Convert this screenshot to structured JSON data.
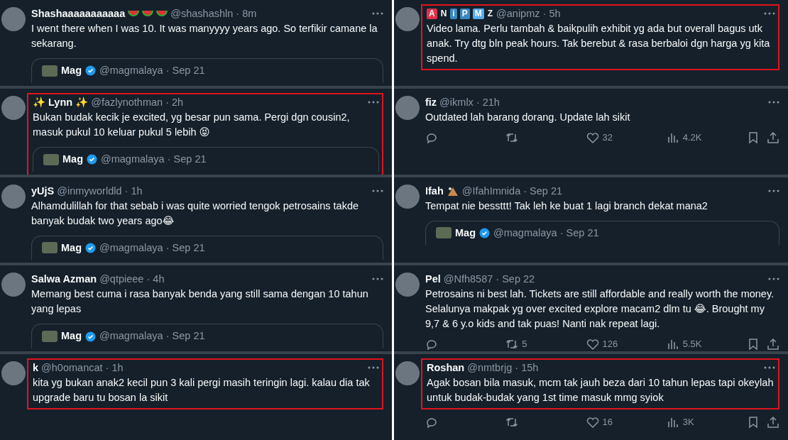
{
  "columns": [
    {
      "tweets": [
        {
          "name": "Shashaaaaaaaaaaa",
          "name_icons": [
            {
              "kind": "watermelon"
            },
            {
              "kind": "watermelon"
            },
            {
              "kind": "watermelon"
            }
          ],
          "meta": "@shashashln · 8m",
          "highlighted": false,
          "text": "I went there when I was 10. It was manyyyy years ago. So terfikir camane la sekarang.",
          "quote": {
            "name": "Mag",
            "meta": "@magmalaya · Sep 21"
          }
        },
        {
          "name": "✨ Lynn ✨",
          "meta": "@fazlynothman · 2h",
          "highlighted": true,
          "text": "Bukan budak kecik je excited, yg besar pun sama. Pergi dgn cousin2, masuk pukul 10 keluar pukul 5 lebih 😝",
          "quote": {
            "name": "Mag",
            "meta": "@magmalaya · Sep 21"
          }
        },
        {
          "name": "yUjS",
          "meta": "@inmyworldld · 1h",
          "highlighted": false,
          "text": "Alhamdulillah for that sebab i was quite worried tengok petrosains takde banyak budak two years ago😂",
          "quote": {
            "name": "Mag",
            "meta": "@magmalaya · Sep 21"
          }
        },
        {
          "name": "Salwa Azman",
          "meta": "@qtpieee · 4h",
          "highlighted": false,
          "text": "Memang best cuma i rasa banyak benda yang still sama dengan 10 tahun yang lepas",
          "quote": {
            "name": "Mag",
            "meta": "@magmalaya · Sep 21"
          }
        },
        {
          "name": "k",
          "meta": "@h0omancat · 1h",
          "highlighted": true,
          "text": "kita yg bukan anak2 kecil pun 3 kali pergi masih teringin lagi. kalau dia tak upgrade baru tu bosan la sikit"
        }
      ]
    },
    {
      "tweets": [
        {
          "name_letters": [
            {
              "letter": "A",
              "color": "#e0314b"
            },
            {
              "letter": "N"
            },
            {
              "letter": "i",
              "color": "#3b88c3"
            },
            {
              "letter": "P",
              "color": "#3b88c3"
            },
            {
              "letter": "M",
              "color": "#55acee"
            },
            {
              "letter": "Z"
            }
          ],
          "meta": "@anipmz · 5h",
          "highlighted": true,
          "text": "Video lama. Perlu tambah & baikpulih exhibit yg ada but overall bagus utk anak. Try dtg bln peak hours. Tak berebut & rasa berbaloi dgn harga yg kita spend."
        },
        {
          "name": "fiz",
          "meta": "@ikmlx · 21h",
          "highlighted": false,
          "text": "Outdated lah barang dorang. Update lah sikit",
          "actions": {
            "likes": "32",
            "views": "4.2K"
          }
        },
        {
          "name": "Ifah",
          "name_icons": [
            {
              "kind": "tent"
            }
          ],
          "meta": "@IfahImnida · Sep 21",
          "highlighted": false,
          "text": "Tempat nie bessttt! Tak leh ke buat 1 lagi branch dekat mana2",
          "quote": {
            "name": "Mag",
            "meta": "@magmalaya · Sep 21"
          }
        },
        {
          "name": "Pel",
          "meta": "@Nfh8587 · Sep 22",
          "highlighted": false,
          "text": "Petrosains ni best lah. Tickets are still affordable and really worth the money. Selalunya makpak yg over excited explore macam2 dlm tu 😂. Brought my 9,7 & 6 y.o kids and tak puas! Nanti nak repeat lagi.",
          "actions": {
            "retweets": "5",
            "likes": "126",
            "views": "5.5K"
          }
        },
        {
          "name": "Roshan",
          "meta": "@nmtbrjg · 15h",
          "highlighted": true,
          "text": "Agak bosan bila masuk, mcm tak jauh beza dari 10 tahun lepas tapi okeylah untuk budak-budak yang 1st time masuk mmg syiok",
          "actions": {
            "likes": "16",
            "views": "3K"
          }
        }
      ]
    }
  ]
}
